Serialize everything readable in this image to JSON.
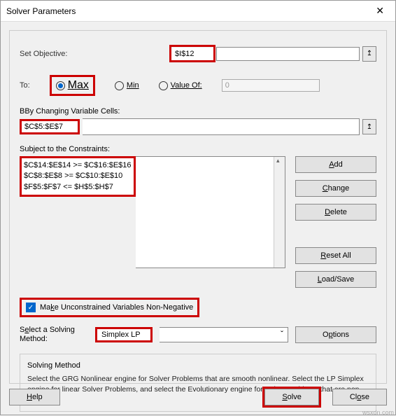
{
  "titlebar": {
    "title": "Solver Parameters",
    "close": "✕"
  },
  "objective": {
    "label": "Set Objective:",
    "value": "$I$12",
    "picker": "↥"
  },
  "to": {
    "label": "To:",
    "max": "Max",
    "min": "Min",
    "valueof": "Value Of:",
    "valueof_value": "0"
  },
  "changing": {
    "label": "By Changing Variable Cells:",
    "value": "$C$5:$E$7",
    "picker": "↥"
  },
  "constraints": {
    "label": "Subject to the Constraints:",
    "items": [
      "$C$14:$E$14 >= $C$16:$E$16",
      "$C$8:$E$8 >= $C$10:$E$10",
      "$F$5:$F$7 <= $H$5:$H$7"
    ]
  },
  "side": {
    "add": "Add",
    "change": "Change",
    "delete": "Delete",
    "reset": "Reset All",
    "loadsave": "Load/Save"
  },
  "nonneg": {
    "label": "Make Unconstrained Variables Non-Negative",
    "check": "✓"
  },
  "method": {
    "label": "Select a Solving Method:",
    "value": "Simplex LP",
    "options_btn": "Options"
  },
  "solving": {
    "title": "Solving Method",
    "desc": "Select the GRG Nonlinear engine for Solver Problems that are smooth nonlinear. Select the LP Simplex engine for linear Solver Problems, and select the Evolutionary engine for Solver problems that are non-smooth."
  },
  "bottom": {
    "help": "Help",
    "solve": "Solve",
    "close": "Close"
  },
  "watermark": "wsxdn.com"
}
